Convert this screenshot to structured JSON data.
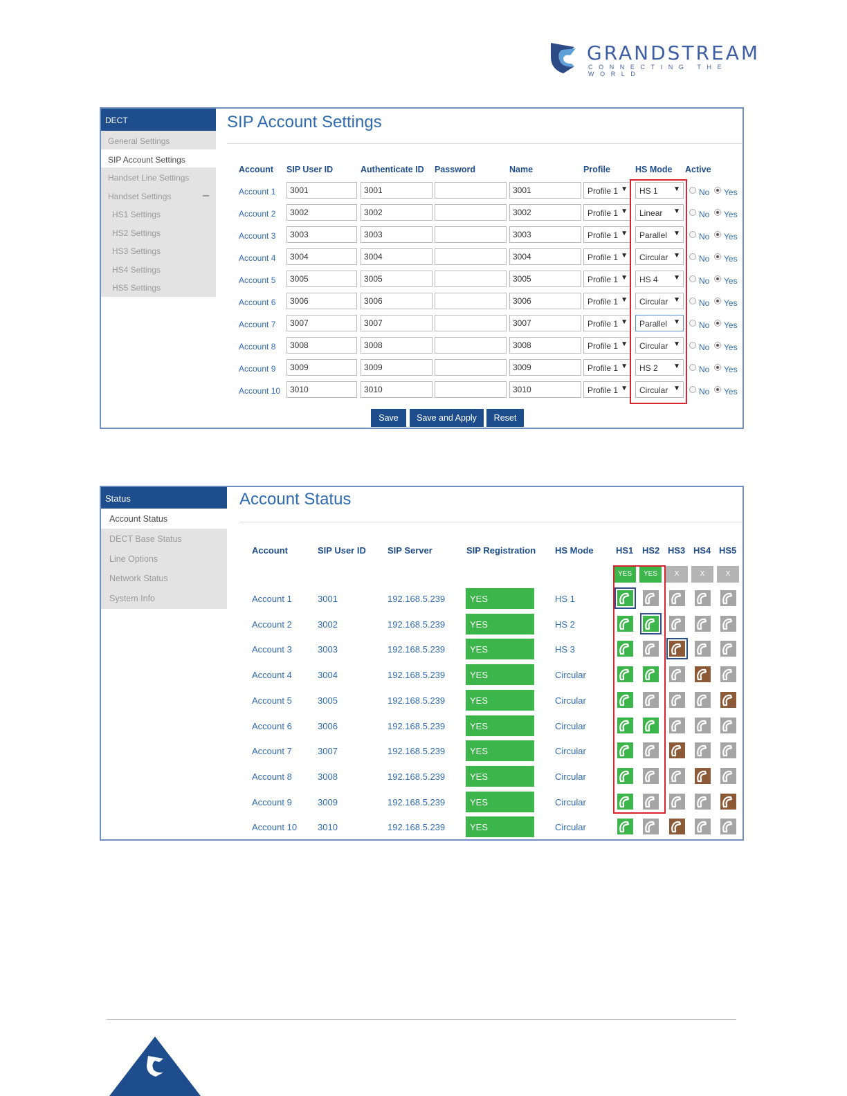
{
  "brand": {
    "name": "GRANDSTREAM",
    "tagline": "CONNECTING THE WORLD",
    "color": "#3d5ea3"
  },
  "panel1": {
    "sidebar": {
      "header": "DECT",
      "items": [
        {
          "label": "General Settings",
          "active": false,
          "sub": false
        },
        {
          "label": "SIP Account Settings",
          "active": true,
          "sub": false
        },
        {
          "label": "Handset Line Settings",
          "active": false,
          "sub": false
        },
        {
          "label": "Handset Settings",
          "active": false,
          "sub": false,
          "collapse_icon": "minus-icon"
        },
        {
          "label": "HS1 Settings",
          "active": false,
          "sub": true
        },
        {
          "label": "HS2 Settings",
          "active": false,
          "sub": true
        },
        {
          "label": "HS3 Settings",
          "active": false,
          "sub": true
        },
        {
          "label": "HS4 Settings",
          "active": false,
          "sub": true
        },
        {
          "label": "HS5 Settings",
          "active": false,
          "sub": true
        }
      ]
    },
    "title": "SIP Account Settings",
    "columns": [
      "Account",
      "SIP User ID",
      "Authenticate ID",
      "Password",
      "Name",
      "Profile",
      "HS Mode",
      "Active"
    ],
    "rows": [
      {
        "account": "Account 1",
        "sip_user_id": "3001",
        "auth_id": "3001",
        "password": "",
        "name": "3001",
        "profile": "Profile 1",
        "hs_mode": "HS 1",
        "active": "Yes"
      },
      {
        "account": "Account 2",
        "sip_user_id": "3002",
        "auth_id": "3002",
        "password": "",
        "name": "3002",
        "profile": "Profile 1",
        "hs_mode": "Linear",
        "active": "Yes"
      },
      {
        "account": "Account 3",
        "sip_user_id": "3003",
        "auth_id": "3003",
        "password": "",
        "name": "3003",
        "profile": "Profile 1",
        "hs_mode": "Parallel",
        "active": "Yes"
      },
      {
        "account": "Account 4",
        "sip_user_id": "3004",
        "auth_id": "3004",
        "password": "",
        "name": "3004",
        "profile": "Profile 1",
        "hs_mode": "Circular",
        "active": "Yes"
      },
      {
        "account": "Account 5",
        "sip_user_id": "3005",
        "auth_id": "3005",
        "password": "",
        "name": "3005",
        "profile": "Profile 1",
        "hs_mode": "HS 4",
        "active": "Yes"
      },
      {
        "account": "Account 6",
        "sip_user_id": "3006",
        "auth_id": "3006",
        "password": "",
        "name": "3006",
        "profile": "Profile 1",
        "hs_mode": "Circular",
        "active": "Yes"
      },
      {
        "account": "Account 7",
        "sip_user_id": "3007",
        "auth_id": "3007",
        "password": "",
        "name": "3007",
        "profile": "Profile 1",
        "hs_mode": "Parallel",
        "active": "Yes"
      },
      {
        "account": "Account 8",
        "sip_user_id": "3008",
        "auth_id": "3008",
        "password": "",
        "name": "3008",
        "profile": "Profile 1",
        "hs_mode": "Circular",
        "active": "Yes"
      },
      {
        "account": "Account 9",
        "sip_user_id": "3009",
        "auth_id": "3009",
        "password": "",
        "name": "3009",
        "profile": "Profile 1",
        "hs_mode": "HS 2",
        "active": "Yes"
      },
      {
        "account": "Account 10",
        "sip_user_id": "3010",
        "auth_id": "3010",
        "password": "",
        "name": "3010",
        "profile": "Profile 1",
        "hs_mode": "Circular",
        "active": "Yes"
      }
    ],
    "radio_no": "No",
    "radio_yes": "Yes",
    "buttons": {
      "save": "Save",
      "save_apply": "Save and Apply",
      "reset": "Reset"
    }
  },
  "panel2": {
    "sidebar": {
      "header": "Status",
      "items": [
        {
          "label": "Account Status",
          "active": true
        },
        {
          "label": "DECT Base Status",
          "active": false
        },
        {
          "label": "Line Options",
          "active": false
        },
        {
          "label": "Network Status",
          "active": false
        },
        {
          "label": "System Info",
          "active": false
        }
      ]
    },
    "title": "Account Status",
    "columns": [
      "Account",
      "SIP User ID",
      "SIP Server",
      "SIP Registration",
      "HS Mode",
      "HS1",
      "HS2",
      "HS3",
      "HS4",
      "HS5"
    ],
    "hs_registered": [
      "YES",
      "YES",
      "X",
      "X",
      "X"
    ],
    "rows": [
      {
        "account": "Account 1",
        "sip_user_id": "3001",
        "server": "192.168.5.239",
        "registration": "YES",
        "hs_mode": "HS 1",
        "phones": [
          "green",
          "gray",
          "gray",
          "gray",
          "gray"
        ],
        "highlight": 0
      },
      {
        "account": "Account 2",
        "sip_user_id": "3002",
        "server": "192.168.5.239",
        "registration": "YES",
        "hs_mode": "HS 2",
        "phones": [
          "green",
          "green",
          "gray",
          "gray",
          "gray"
        ],
        "highlight": 1
      },
      {
        "account": "Account 3",
        "sip_user_id": "3003",
        "server": "192.168.5.239",
        "registration": "YES",
        "hs_mode": "HS 3",
        "phones": [
          "green",
          "gray",
          "brown",
          "gray",
          "gray"
        ],
        "highlight": 2
      },
      {
        "account": "Account 4",
        "sip_user_id": "3004",
        "server": "192.168.5.239",
        "registration": "YES",
        "hs_mode": "Circular",
        "phones": [
          "green",
          "green",
          "gray",
          "brown",
          "gray"
        ],
        "highlight": -1
      },
      {
        "account": "Account 5",
        "sip_user_id": "3005",
        "server": "192.168.5.239",
        "registration": "YES",
        "hs_mode": "Circular",
        "phones": [
          "green",
          "gray",
          "gray",
          "gray",
          "brown"
        ],
        "highlight": -1
      },
      {
        "account": "Account 6",
        "sip_user_id": "3006",
        "server": "192.168.5.239",
        "registration": "YES",
        "hs_mode": "Circular",
        "phones": [
          "green",
          "green",
          "gray",
          "gray",
          "gray"
        ],
        "highlight": -1
      },
      {
        "account": "Account 7",
        "sip_user_id": "3007",
        "server": "192.168.5.239",
        "registration": "YES",
        "hs_mode": "Circular",
        "phones": [
          "green",
          "gray",
          "brown",
          "gray",
          "gray"
        ],
        "highlight": -1
      },
      {
        "account": "Account 8",
        "sip_user_id": "3008",
        "server": "192.168.5.239",
        "registration": "YES",
        "hs_mode": "Circular",
        "phones": [
          "green",
          "gray",
          "gray",
          "brown",
          "gray"
        ],
        "highlight": -1
      },
      {
        "account": "Account 9",
        "sip_user_id": "3009",
        "server": "192.168.5.239",
        "registration": "YES",
        "hs_mode": "Circular",
        "phones": [
          "green",
          "gray",
          "gray",
          "gray",
          "brown"
        ],
        "highlight": -1
      },
      {
        "account": "Account 10",
        "sip_user_id": "3010",
        "server": "192.168.5.239",
        "registration": "YES",
        "hs_mode": "Circular",
        "phones": [
          "green",
          "gray",
          "brown",
          "gray",
          "gray"
        ],
        "highlight": -1
      }
    ]
  },
  "colors": {
    "nav": "#1d4d8c",
    "registered": "#3cb54a",
    "highlight_red": "#d9232e",
    "phone_gray": "#a5a5a5",
    "phone_brown": "#8c5a36"
  }
}
